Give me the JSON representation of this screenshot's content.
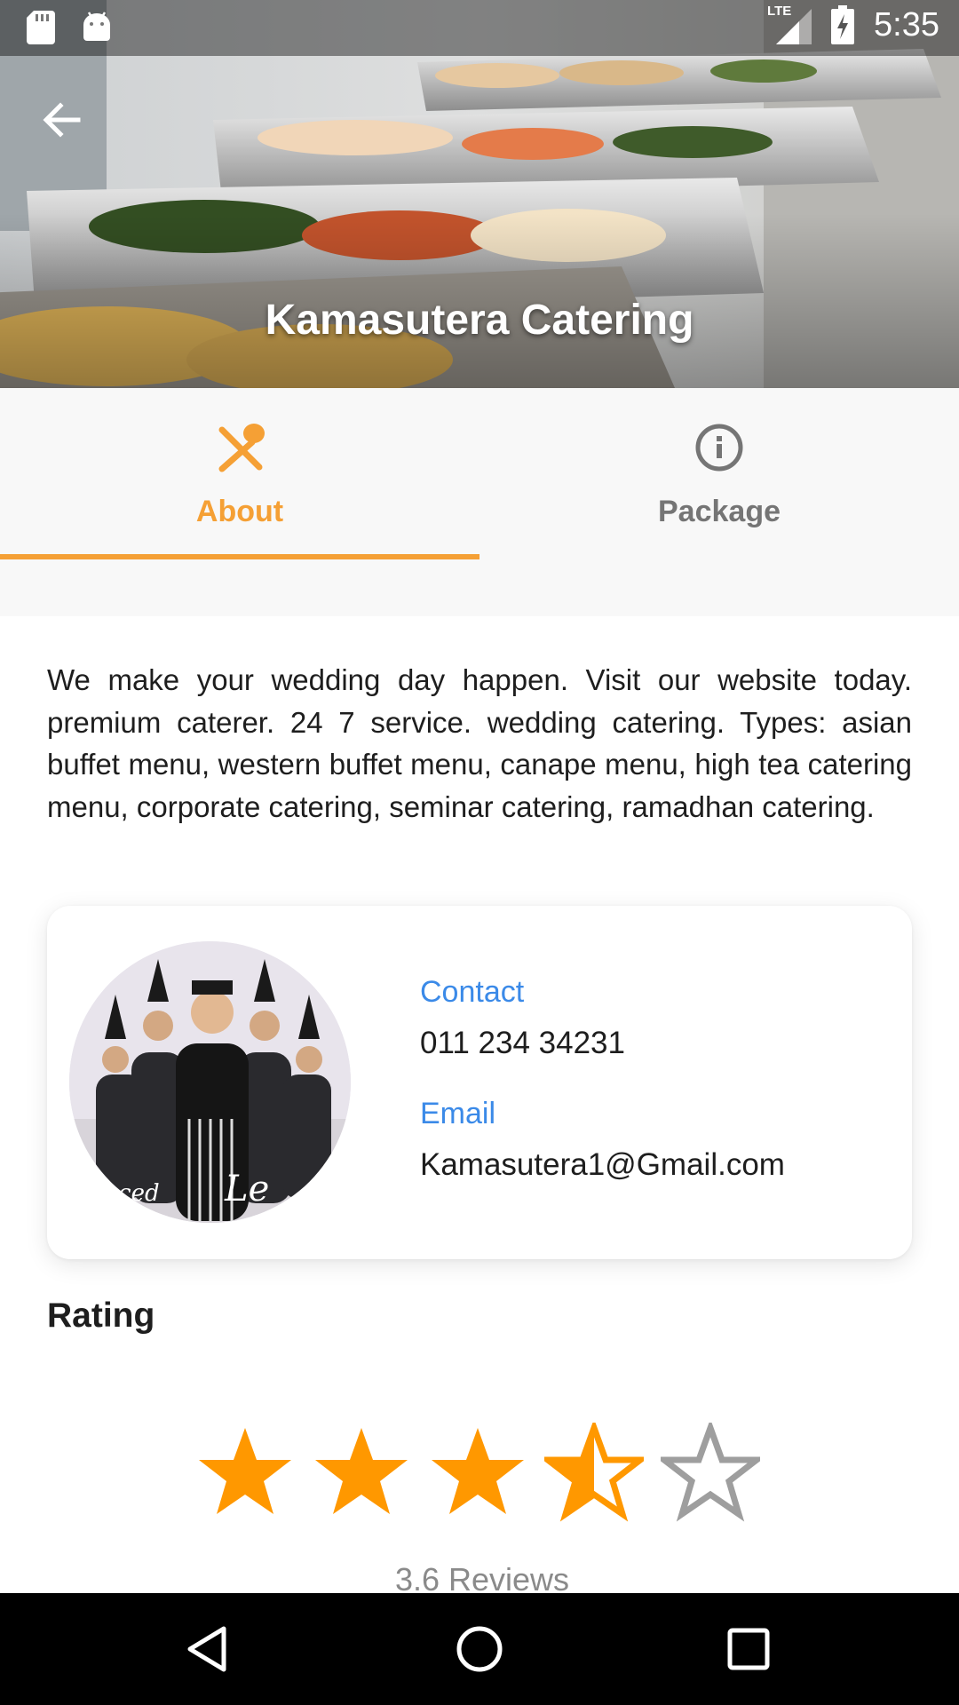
{
  "status_bar": {
    "time": "5:35",
    "network": "LTE",
    "icons": [
      "sd-card-icon",
      "android-icon",
      "signal-icon",
      "battery-charging-icon"
    ]
  },
  "header": {
    "title": "Kamasutera Catering",
    "back_icon": "arrow-back-icon"
  },
  "tabs": [
    {
      "label": "About",
      "icon": "fork-spoon-icon",
      "selected": true
    },
    {
      "label": "Package",
      "icon": "info-icon",
      "selected": false
    }
  ],
  "about": {
    "description": "We make your wedding day happen. Visit our website today. premium caterer. 24 7 service. wedding catering. Types: asian buffet menu, western buffet menu, canape menu, high tea catering menu, corporate catering, seminar catering, ramadhan catering."
  },
  "info_card": {
    "contact_label": "Contact",
    "contact_value": "011 234 34231",
    "email_label": "Email",
    "email_value": "Kamasutera1@Gmail.com"
  },
  "rating": {
    "title": "Rating",
    "value": 3.6,
    "max": 5,
    "reviews_text": "3.6 Reviews"
  },
  "colors": {
    "accent": "#f5a035",
    "star": "#ff9800",
    "link": "#3b8ae8",
    "tab_inactive": "#757575"
  },
  "nav_bar": {
    "icons": [
      "nav-back-icon",
      "nav-home-icon",
      "nav-recent-apps-icon"
    ]
  }
}
